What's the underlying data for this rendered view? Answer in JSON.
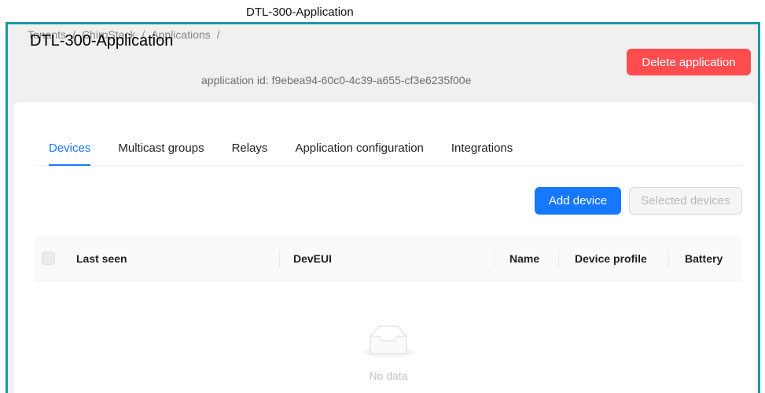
{
  "window": {
    "title": "DTL-300-Application"
  },
  "colors": {
    "frame": "#1b98a3",
    "accent": "#1677ff",
    "danger": "#ff4d4f",
    "page_bg": "#f0f0f0",
    "card_bg": "#ffffff"
  },
  "breadcrumb": {
    "items": [
      "Tenants",
      "ChirpStack",
      "Applications"
    ],
    "separator": "/"
  },
  "header": {
    "title": "DTL-300-Application",
    "application_id_label": "application id:",
    "application_id": "f9ebea94-60c0-4c39-a655-cf3e6235f00e",
    "delete_label": "Delete application"
  },
  "tabs": [
    {
      "label": "Devices",
      "active": true
    },
    {
      "label": "Multicast groups",
      "active": false
    },
    {
      "label": "Relays",
      "active": false
    },
    {
      "label": "Application configuration",
      "active": false
    },
    {
      "label": "Integrations",
      "active": false
    }
  ],
  "toolbar": {
    "add_device_label": "Add device",
    "selected_devices_label": "Selected devices",
    "selected_devices_disabled": true
  },
  "table": {
    "columns": [
      "Last seen",
      "DevEUI",
      "Name",
      "Device profile",
      "Battery"
    ],
    "select_all_checked": false,
    "select_all_disabled": true,
    "rows": [],
    "empty_text": "No data"
  },
  "icons": {
    "empty": "inbox-empty-icon"
  }
}
